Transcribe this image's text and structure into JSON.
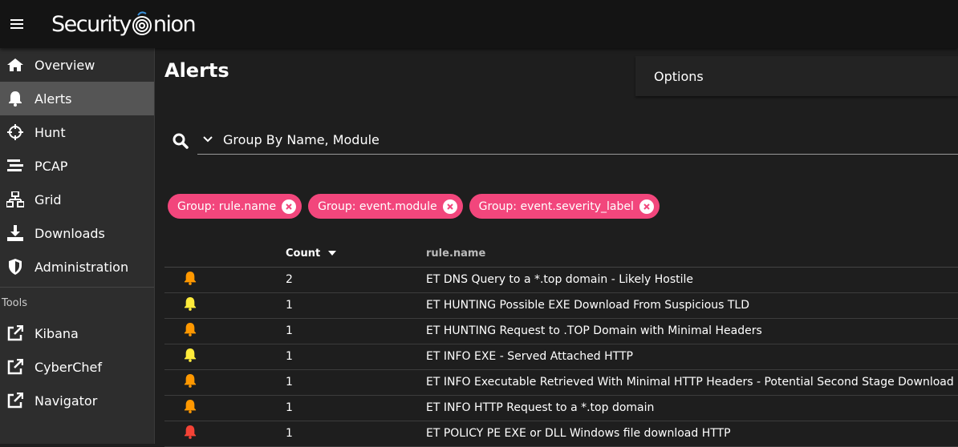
{
  "brand": {
    "name_left": "Security",
    "name_right": "nion"
  },
  "nav": [
    {
      "label": "Overview",
      "icon": "home-icon",
      "active": false
    },
    {
      "label": "Alerts",
      "icon": "bell-icon",
      "active": true
    },
    {
      "label": "Hunt",
      "icon": "crosshairs-icon",
      "active": false
    },
    {
      "label": "PCAP",
      "icon": "stream-icon",
      "active": false
    },
    {
      "label": "Grid",
      "icon": "sitemap-icon",
      "active": false
    },
    {
      "label": "Downloads",
      "icon": "download-icon",
      "active": false
    },
    {
      "label": "Administration",
      "icon": "shield-icon",
      "active": false
    }
  ],
  "tools": {
    "heading": "Tools",
    "items": [
      {
        "label": "Kibana",
        "icon": "external-link-icon"
      },
      {
        "label": "CyberChef",
        "icon": "external-link-icon"
      },
      {
        "label": "Navigator",
        "icon": "external-link-icon"
      }
    ]
  },
  "page": {
    "title": "Alerts",
    "options_label": "Options"
  },
  "query": {
    "text": "Group By Name, Module"
  },
  "chips": [
    {
      "label": "Group: rule.name"
    },
    {
      "label": "Group: event.module"
    },
    {
      "label": "Group: event.severity_label"
    }
  ],
  "table": {
    "headers": {
      "count": "Count",
      "rule": "rule.name"
    },
    "rows": [
      {
        "severity": "medium",
        "count": "2",
        "rule": "ET DNS Query to a *.top domain - Likely Hostile"
      },
      {
        "severity": "low",
        "count": "1",
        "rule": "ET HUNTING Possible EXE Download From Suspicious TLD"
      },
      {
        "severity": "medium",
        "count": "1",
        "rule": "ET HUNTING Request to .TOP Domain with Minimal Headers"
      },
      {
        "severity": "low",
        "count": "1",
        "rule": "ET INFO EXE - Served Attached HTTP"
      },
      {
        "severity": "medium",
        "count": "1",
        "rule": "ET INFO Executable Retrieved With Minimal HTTP Headers - Potential Second Stage Download"
      },
      {
        "severity": "medium",
        "count": "1",
        "rule": "ET INFO HTTP Request to a *.top domain"
      },
      {
        "severity": "high",
        "count": "1",
        "rule": "ET POLICY PE EXE or DLL Windows file download HTTP"
      }
    ]
  },
  "colors": {
    "chip": "#f2467c",
    "severity_low": "#ffeb3b",
    "severity_medium": "#ff9800",
    "severity_high": "#f44336"
  }
}
